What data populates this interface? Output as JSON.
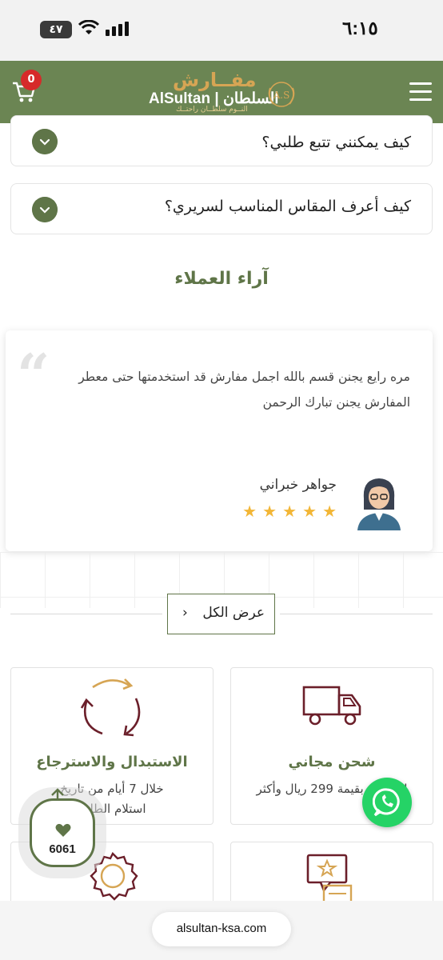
{
  "status_bar": {
    "time": "٦:١٥",
    "battery": "٤٧"
  },
  "header": {
    "cart_count": "0",
    "logo_ar": "مفــارش",
    "logo_name": "AlSultan | السلطان",
    "logo_tagline": "النــوم سلطــان راحتــك",
    "logo_seal": "A.S"
  },
  "faq": [
    {
      "question": "كيف يمكنني تتبع طلبي؟"
    },
    {
      "question": "كيف أعرف المقاس المناسب لسريري؟"
    }
  ],
  "reviews": {
    "title": "آراء العملاء",
    "text": "مره رايع يجنن قسم بالله اجمل مفارش قد استخدمتها حتى معطر المفارش يجنن تبارك الرحمن",
    "reviewer": "جواهر خبراني",
    "rating": 5,
    "star_glyph": "★",
    "view_all": "عرض الكل",
    "view_all_chevron": "›"
  },
  "features": [
    {
      "title": "شحن مجاني",
      "subtitle": "للطلبات بقيمة 299 ريال وأكثر",
      "icon": "truck-icon"
    },
    {
      "title": "الاستبدال والاسترجاع",
      "subtitle": "خلال 7 أيام من تاريخ استلام الطلب",
      "icon": "exchange-arrows-icon"
    },
    {
      "title": "",
      "subtitle": "",
      "icon": "review-document-icon"
    },
    {
      "title": "",
      "subtitle": "",
      "icon": "quality-badge-icon"
    }
  ],
  "floating": {
    "likes_count": "6061"
  },
  "browser": {
    "url": "alsultan-ksa.com"
  },
  "colors": {
    "brand_green": "#6b8553",
    "gold": "#d6a554",
    "maroon": "#6b1f2a",
    "whatsapp": "#25d366",
    "badge_red": "#d62a2a",
    "star": "#f2b636"
  }
}
